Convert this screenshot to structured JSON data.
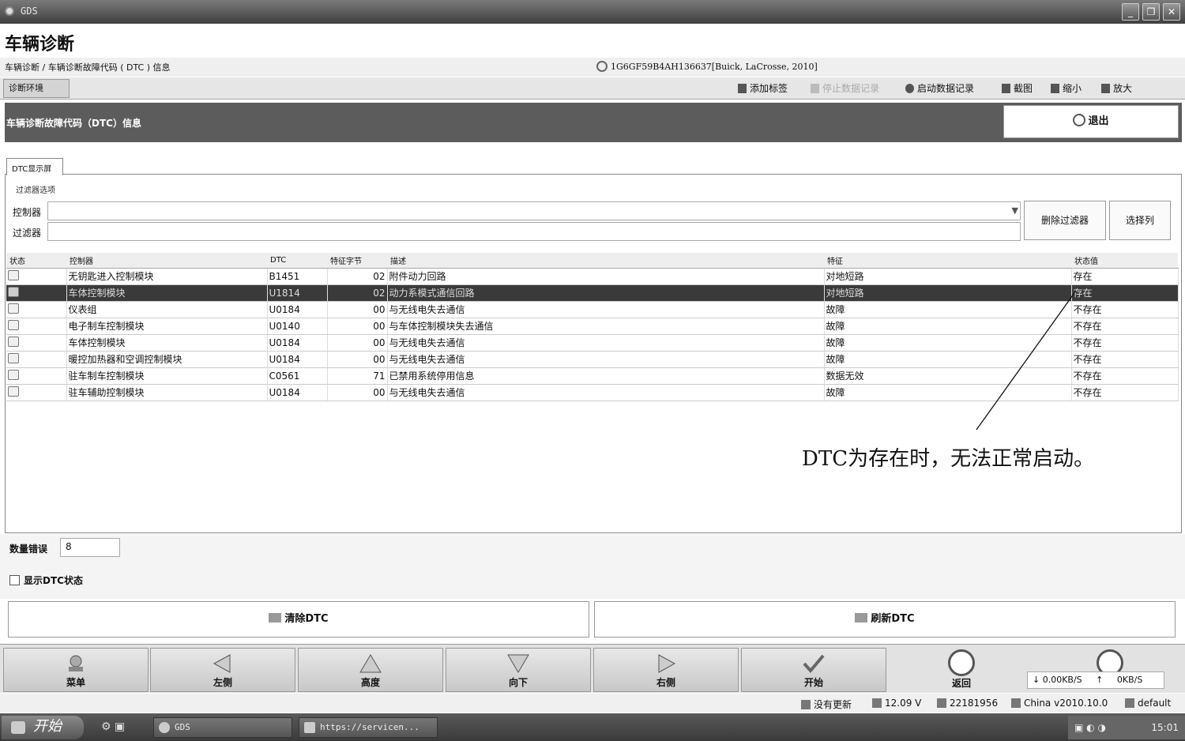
{
  "window": {
    "title": "GDS"
  },
  "app": {
    "title": "车辆诊断"
  },
  "breadcrumb": "车辆诊断 / 车辆诊断故障代码 ( DTC ) 信息",
  "vehicle": "1G6GF59B4AH136637[Buick, LaCrosse, 2010]",
  "toolbar": {
    "env_tab": "诊断环境",
    "add_bookmark": "添加标签",
    "stop_recording": "停止数据记录",
    "start_recording": "启动数据记录",
    "screenshot": "截图",
    "zoom_out": "缩小",
    "zoom_in": "放大"
  },
  "header": {
    "title": "车辆诊断故障代码（DTC）信息",
    "exit_label": "退出"
  },
  "dtc_tab": "DTC显示屏",
  "filter": {
    "section_title": "过滤器选项",
    "controller_label": "控制器",
    "filter_label": "过滤器",
    "remove_filter": "删除过滤器",
    "select_columns": "选择列"
  },
  "table": {
    "columns": [
      "状态",
      "控制器",
      "DTC",
      "特征字节",
      "描述",
      "特征",
      "状态值"
    ],
    "rows": [
      {
        "controller": "无钥匙进入控制模块",
        "dtc": "B1451",
        "byte": "02",
        "desc": "附件动力回路",
        "feature": "对地短路",
        "status": "存在",
        "selected": false
      },
      {
        "controller": "车体控制模块",
        "dtc": "U1814",
        "byte": "02",
        "desc": "动力系模式通信回路",
        "feature": "对地短路",
        "status": "存在",
        "selected": true
      },
      {
        "controller": "仪表组",
        "dtc": "U0184",
        "byte": "00",
        "desc": "与无线电失去通信",
        "feature": "故障",
        "status": "不存在",
        "selected": false
      },
      {
        "controller": "电子制车控制模块",
        "dtc": "U0140",
        "byte": "00",
        "desc": "与车体控制模块失去通信",
        "feature": "故障",
        "status": "不存在",
        "selected": false
      },
      {
        "controller": "车体控制模块",
        "dtc": "U0184",
        "byte": "00",
        "desc": "与无线电失去通信",
        "feature": "故障",
        "status": "不存在",
        "selected": false
      },
      {
        "controller": "暖控加热器和空调控制模块",
        "dtc": "U0184",
        "byte": "00",
        "desc": "与无线电失去通信",
        "feature": "故障",
        "status": "不存在",
        "selected": false
      },
      {
        "controller": "驻车制车控制模块",
        "dtc": "C0561",
        "byte": "71",
        "desc": "已禁用系统停用信息",
        "feature": "数据无效",
        "status": "不存在",
        "selected": false
      },
      {
        "controller": "驻车辅助控制模块",
        "dtc": "U0184",
        "byte": "00",
        "desc": "与无线电失去通信",
        "feature": "故障",
        "status": "不存在",
        "selected": false
      }
    ]
  },
  "annotation": "DTC为存在时，无法正常启动。",
  "count": {
    "label": "数量错误",
    "value": "8"
  },
  "show_status": "显示DTC状态",
  "actions": {
    "clear": "清除DTC",
    "refresh": "刷新DTC"
  },
  "nav": {
    "menu": "菜单",
    "left": "左侧",
    "up": "高度",
    "down": "向下",
    "right": "右侧",
    "start": "开始",
    "back": "返回",
    "speed_down": "0.00KB/S",
    "speed_up": "0KB/S"
  },
  "status": {
    "updates": "没有更新",
    "time": "12.09 V",
    "code": "22181956",
    "version": "China v2010.10.0",
    "user": "default"
  },
  "taskbar": {
    "start": "开始",
    "item1": "GDS",
    "item2": "https://servicen...",
    "clock": "15:01"
  }
}
